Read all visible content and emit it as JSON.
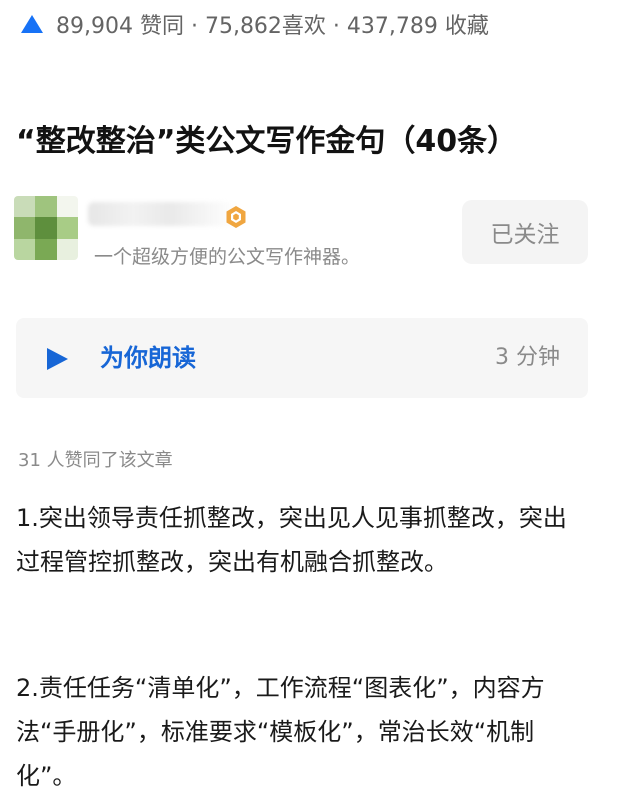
{
  "stats": {
    "icon": "upvote-triangle-icon",
    "accent": "#1772f6",
    "text": "89,904 赞同 · 75,862喜欢 · 437,789 收藏"
  },
  "article": {
    "title": "“整改整治”类公文写作金句（40条）"
  },
  "author": {
    "bio": "一个超级方便的公文写作神器。",
    "follow_label": "已关注"
  },
  "reader": {
    "label": "为你朗读",
    "duration": "3 分钟",
    "accent": "#1766d6"
  },
  "likes_note": "31 人赞同了该文章",
  "content": {
    "paragraphs": [
      "1.突出领导责任抓整改，突出见人见事抓整改，突出过程管控抓整改，突出有机融合抓整改。",
      "2.责任任务“清单化”，工作流程“图表化”，内容方法“手册化”，标准要求“模板化”，常治长效“机制化”。"
    ]
  }
}
